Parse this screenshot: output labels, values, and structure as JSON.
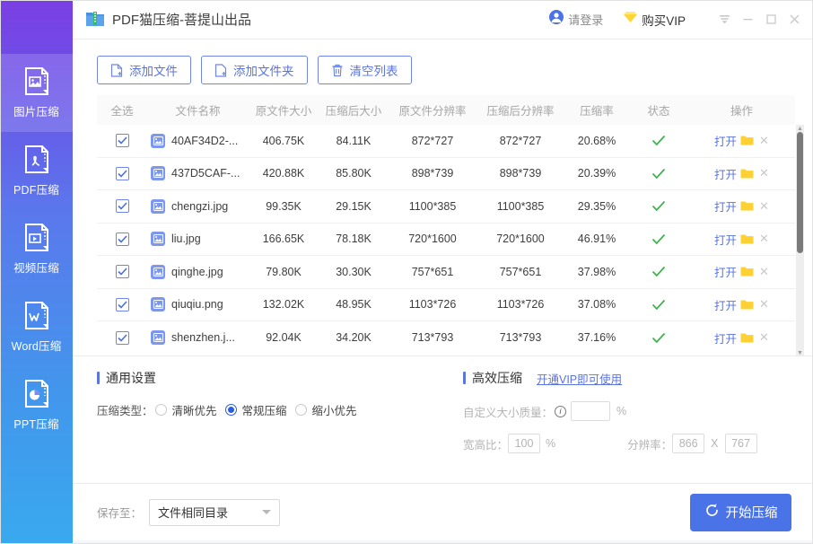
{
  "window": {
    "title": "PDF猫压缩-菩提山出品",
    "app_icon": "zip-folder-icon",
    "login_label": "请登录",
    "vip_label": "购买VIP",
    "controls": {
      "menu": "menu-icon",
      "minimize": "minimize-icon",
      "maximize": "maximize-icon",
      "close": "close-icon"
    }
  },
  "sidebar": {
    "items": [
      {
        "label": "图片压缩",
        "icon": "image-file-icon",
        "active": true
      },
      {
        "label": "PDF压缩",
        "icon": "pdf-file-icon",
        "active": false
      },
      {
        "label": "视频压缩",
        "icon": "video-file-icon",
        "active": false
      },
      {
        "label": "Word压缩",
        "icon": "word-file-icon",
        "active": false
      },
      {
        "label": "PPT压缩",
        "icon": "ppt-file-icon",
        "active": false
      }
    ]
  },
  "toolbar": {
    "add_file": "添加文件",
    "add_folder": "添加文件夹",
    "clear_list": "清空列表"
  },
  "table": {
    "headers": {
      "select_all": "全选",
      "file_name": "文件名称",
      "original_size": "原文件大小",
      "compressed_size": "压缩后大小",
      "original_resolution": "原文件分辨率",
      "compressed_resolution": "压缩后分辨率",
      "ratio": "压缩率",
      "status": "状态",
      "action": "操作"
    },
    "open_label": "打开",
    "rows": [
      {
        "checked": true,
        "name": "40AF34D2-...",
        "osize": "406.75K",
        "csize": "84.11K",
        "ores": "872*727",
        "cres": "872*727",
        "ratio": "20.68%",
        "done": true
      },
      {
        "checked": true,
        "name": "437D5CAF-...",
        "osize": "420.88K",
        "csize": "85.80K",
        "ores": "898*739",
        "cres": "898*739",
        "ratio": "20.39%",
        "done": true
      },
      {
        "checked": true,
        "name": "chengzi.jpg",
        "osize": "99.35K",
        "csize": "29.15K",
        "ores": "1100*385",
        "cres": "1100*385",
        "ratio": "29.35%",
        "done": true
      },
      {
        "checked": true,
        "name": "liu.jpg",
        "osize": "166.65K",
        "csize": "78.18K",
        "ores": "720*1600",
        "cres": "720*1600",
        "ratio": "46.91%",
        "done": true
      },
      {
        "checked": true,
        "name": "qinghe.jpg",
        "osize": "79.80K",
        "csize": "30.30K",
        "ores": "757*651",
        "cres": "757*651",
        "ratio": "37.98%",
        "done": true
      },
      {
        "checked": true,
        "name": "qiuqiu.png",
        "osize": "132.02K",
        "csize": "48.95K",
        "ores": "1103*726",
        "cres": "1103*726",
        "ratio": "37.08%",
        "done": true
      },
      {
        "checked": true,
        "name": "shenzhen.j...",
        "osize": "92.04K",
        "csize": "34.20K",
        "ores": "713*793",
        "cres": "713*793",
        "ratio": "37.16%",
        "done": true
      }
    ]
  },
  "general_settings": {
    "title": "通用设置",
    "type_label": "压缩类型：",
    "options": [
      {
        "label": "清晰优先",
        "selected": false
      },
      {
        "label": "常规压缩",
        "selected": true
      },
      {
        "label": "缩小优先",
        "selected": false
      }
    ]
  },
  "efficient_settings": {
    "title": "高效压缩",
    "vip_link": "开通VIP即可使用",
    "quality_label": "自定义大小质量：",
    "quality_value": "",
    "percent": "%",
    "ratio_label": "宽高比：",
    "ratio_value": "100",
    "ratio_percent": "%",
    "resolution_label": "分辨率：",
    "resolution_width": "866",
    "resolution_sep": "X",
    "resolution_height": "767"
  },
  "bottom": {
    "save_label": "保存至：",
    "save_value": "文件相同目录",
    "start_label": "开始压缩"
  },
  "colors": {
    "accent_blue": "#5b74e0",
    "button_blue": "#4a73e8",
    "radio_blue": "#2b5ce8",
    "success_green": "#3bb34a",
    "vip_yellow": "#fdd535",
    "folder_yellow": "#fdd033",
    "sidebar_top": "#7b3fe4",
    "sidebar_bottom": "#39a9ef"
  }
}
